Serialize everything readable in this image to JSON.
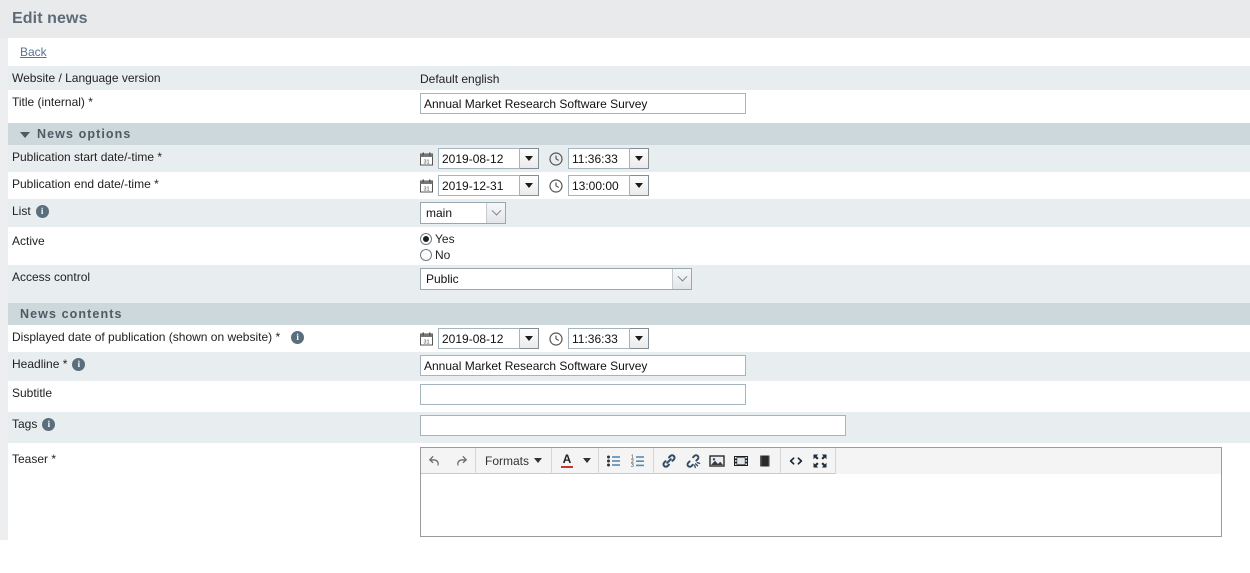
{
  "header": {
    "page_title": "Edit news",
    "back_label": "Back"
  },
  "colors": {
    "title_bar_bg": "#e9eaec",
    "title_text": "#5d6b78",
    "section_bg": "#cdd8dd",
    "row_shade": "#e8edf0",
    "row_plain": "#ffffff",
    "link": "#5a7391",
    "info_icon": "#5b6e7d"
  },
  "top_fields": [
    {
      "label": "Website / Language version",
      "type": "static",
      "value": "Default english"
    },
    {
      "label": "Title (internal) *",
      "type": "text",
      "value": "Annual Market Research Software Survey",
      "placeholder": ""
    }
  ],
  "sections": [
    {
      "id": "news-options",
      "title": "News options",
      "collapsible": true,
      "collapse_icon": "triangle-down-icon"
    },
    {
      "id": "news-contents",
      "title": "News contents",
      "collapsible": false,
      "collapse_icon": ""
    }
  ],
  "news_options": {
    "publication_start": {
      "label": "Publication start date/-time *",
      "date_value": "2019-08-12",
      "time_value": "11:36:33",
      "calendar_icon": "calendar-icon",
      "clock_icon": "clock-icon"
    },
    "publication_end": {
      "label": "Publication end date/-time *",
      "date_value": "2019-12-31",
      "time_value": "13:00:00",
      "calendar_icon": "calendar-icon",
      "clock_icon": "clock-icon"
    },
    "list": {
      "label": "List",
      "info_icon": "info-icon",
      "selected": "main",
      "options": [
        "main"
      ]
    },
    "active": {
      "label": "Active",
      "selected": "Yes",
      "options": [
        {
          "label": "Yes",
          "checked": true
        },
        {
          "label": "No",
          "checked": false
        }
      ]
    },
    "access_control": {
      "label": "Access control",
      "selected": "Public",
      "options": [
        "Public"
      ]
    }
  },
  "news_contents": {
    "displayed_date": {
      "label": "Displayed date of publication (shown on website) *",
      "info_icon": "info-icon",
      "date_value": "2019-08-12",
      "time_value": "11:36:33",
      "calendar_icon": "calendar-icon",
      "clock_icon": "clock-icon"
    },
    "headline": {
      "label": "Headline *",
      "info_icon": "info-icon",
      "value": "Annual Market Research Software Survey",
      "placeholder": ""
    },
    "subtitle": {
      "label": "Subtitle",
      "value": "",
      "placeholder": "",
      "focused": true
    },
    "tags": {
      "label": "Tags",
      "info_icon": "info-icon",
      "value": "",
      "placeholder": ""
    },
    "teaser": {
      "label": "Teaser *",
      "content": "",
      "toolbar_groups": [
        {
          "name": "history",
          "items": [
            {
              "name": "undo-icon",
              "label": "Undo"
            },
            {
              "name": "redo-icon",
              "label": "Redo"
            }
          ]
        },
        {
          "name": "formats",
          "items": [
            {
              "name": "formats-dropdown",
              "label": "Formats"
            }
          ]
        },
        {
          "name": "text-color",
          "items": [
            {
              "name": "text-color-icon",
              "label": "A"
            }
          ]
        },
        {
          "name": "lists",
          "items": [
            {
              "name": "bullet-list-icon",
              "label": "Bullet list"
            },
            {
              "name": "numbered-list-icon",
              "label": "Numbered list"
            }
          ]
        },
        {
          "name": "insert",
          "items": [
            {
              "name": "link-icon",
              "label": "Insert link"
            },
            {
              "name": "unlink-icon",
              "label": "Remove link"
            },
            {
              "name": "image-icon",
              "label": "Insert image"
            },
            {
              "name": "media-icon",
              "label": "Insert media"
            },
            {
              "name": "book-icon",
              "label": "Insert document"
            }
          ]
        },
        {
          "name": "tools",
          "items": [
            {
              "name": "source-code-icon",
              "label": "Source code"
            },
            {
              "name": "fullscreen-icon",
              "label": "Fullscreen"
            }
          ]
        }
      ]
    }
  }
}
